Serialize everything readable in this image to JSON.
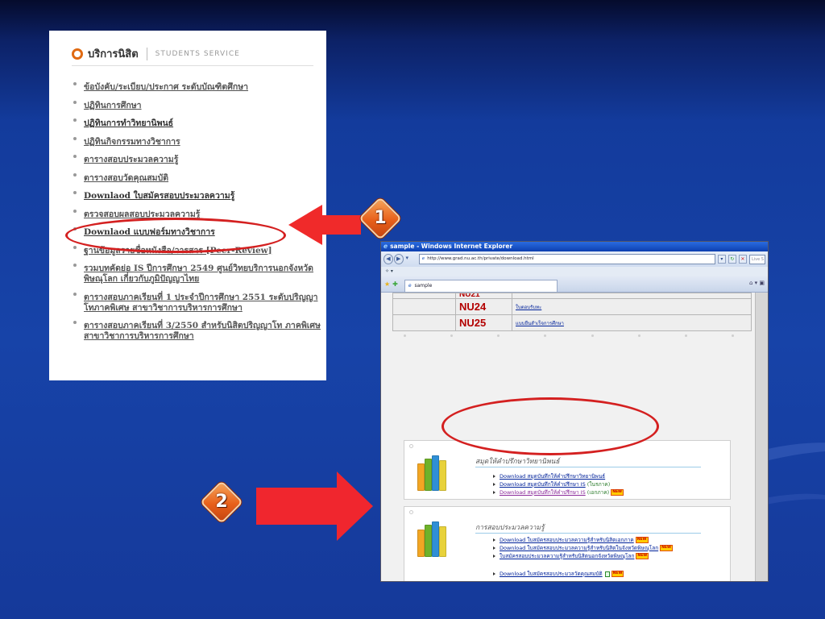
{
  "left_panel": {
    "title": "บริการนิสิต",
    "subtitle": "STUDENTS SERVICE",
    "items": [
      "ข้อบังคับ/ระเบียบ/ประกาศ ระดับบัณฑิตศึกษา",
      "ปฏิทินการศึกษา",
      "ปฏิทินการทำวิทยานิพนธ์",
      "ปฏิทินกิจกรรมทางวิชาการ",
      "ตารางสอบประมวลความรู้",
      "ตารางสอบวัดคุณสมบัติ",
      "Downlaod ใบสมัครสอบประมวลความรู้",
      "ตรวจสอบผลสอบประมวลความรู้",
      "Downlaod แบบฟอร์มทางวิชาการ",
      "ฐานข้อมูลรายชื่อหนังสือ/วารสาร [Peer-Review]",
      "รวมบทคัดย่อ IS ปีการศึกษา 2549 ศูนย์วิทยบริการนอกจังหวัดพิษณุโลก เกี่ยวกับภูมิปัญญาไทย",
      "ตารางสอบภาคเรียนที่ 1 ประจำปีการศึกษา 2551 ระดับปริญญาโทภาคพิเศษ สาขาวิชาการบริหารการศึกษา",
      "ตารางสอบภาคเรียนที่ 3/2550 สำหรับนิสิตปริญญาโท ภาคพิเศษ สาขาวิชาการบริหารการศึกษา"
    ]
  },
  "badges": {
    "one": "1",
    "two": "2"
  },
  "browser": {
    "window_title": "sample - Windows Internet Explorer",
    "address": "http://www.grad.nu.ac.th/private/download.html",
    "search_placeholder": "Live S",
    "tab_label": "sample",
    "table": [
      {
        "code": "NU21",
        "link": ""
      },
      {
        "code": "NU24",
        "link": "ใบตอบรับทะ"
      },
      {
        "code": "NU25",
        "link": "แบบยืนสำเร็จการศึกษา"
      }
    ],
    "section1": {
      "title": "สมุดให้คำปรึกษาวิทยานิพนธ์",
      "links": [
        {
          "text": "Download สมุดบันทึกให้คำปรึกษาวิทยานิพนธ์",
          "paren": "",
          "new": false,
          "visited": false
        },
        {
          "text": "Download สมุดบันทึกให้คำปรึกษา IS",
          "paren": "(ในรภาค)",
          "new": false,
          "visited": false
        },
        {
          "text": "Download สมุดบันทึกให้คำปรึกษา IS",
          "paren": "(เอกภาค)",
          "new": true,
          "visited": true
        }
      ]
    },
    "section2": {
      "title": "การสอบประมวลความรู้",
      "links": [
        {
          "text": "Download ใบสมัครสอบประมวลความรู้สำหรับนิสิตเอกภาค",
          "new": true
        },
        {
          "text": "Download ใบสมัครสอบประมวลความรู้สำหรับนิสิตในจังหวัดพิษณุโลก",
          "new": true
        },
        {
          "text": "ใบสมัครสอบประมวลความรู้สำหรับนิสิตนอกจังหวัดพิษณุโลก",
          "new": true
        }
      ],
      "extra_link": "Download ใบสมัครสอบประมวลวัดคุณสมบัติ",
      "new_label": "NEW"
    }
  }
}
